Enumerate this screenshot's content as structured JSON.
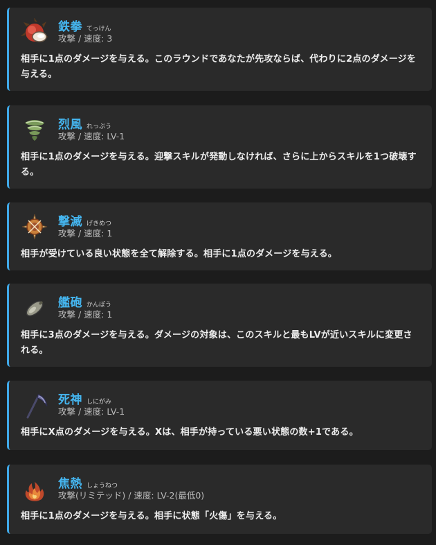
{
  "skills": [
    {
      "name": "鉄拳",
      "ruby": "てっけん",
      "meta": "攻撃 / 速度: 3",
      "description": "相手に1点のダメージを与える。このラウンドであなたが先攻ならば、代わりに2点のダメージを与える。",
      "icon": "iron-fist-icon"
    },
    {
      "name": "烈風",
      "ruby": "れっぷう",
      "meta": "攻撃 / 速度: LV-1",
      "description": "相手に1点のダメージを与える。迎撃スキルが発動しなければ、さらに上からスキルを1つ破壊する。",
      "icon": "whirlwind-icon"
    },
    {
      "name": "撃滅",
      "ruby": "げきめつ",
      "meta": "攻撃 / 速度: 1",
      "description": "相手が受けている良い状態を全て解除する。相手に1点のダメージを与える。",
      "icon": "shattered-target-icon"
    },
    {
      "name": "艦砲",
      "ruby": "かんぽう",
      "meta": "攻撃 / 速度: 1",
      "description": "相手に3点のダメージを与える。ダメージの対象は、このスキルと最もLVが近いスキルに変更される。",
      "icon": "cannon-shell-icon"
    },
    {
      "name": "死神",
      "ruby": "しにがみ",
      "meta": "攻撃 / 速度: LV-1",
      "description": "相手にX点のダメージを与える。Xは、相手が持っている悪い状態の数+1である。",
      "icon": "scythe-icon"
    },
    {
      "name": "焦熱",
      "ruby": "しょうねつ",
      "meta": "攻撃(リミテッド) / 速度: LV-2(最低0)",
      "description": "相手に1点のダメージを与える。相手に状態「火傷」を与える。",
      "icon": "flames-icon"
    }
  ],
  "colors": {
    "accent": "#3fa9e8",
    "name": "#45b6f0",
    "card": "#2a2a2a",
    "background": "#1c1c1c"
  }
}
